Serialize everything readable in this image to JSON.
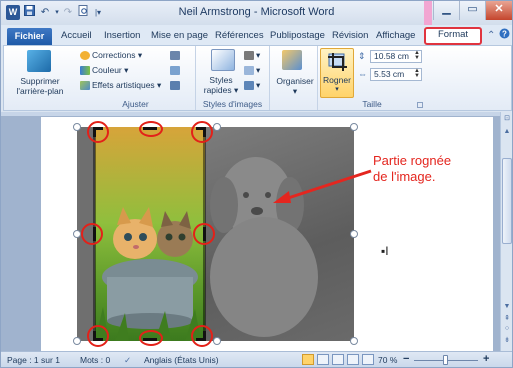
{
  "window": {
    "title": "Neil Armstrong - Microsoft Word"
  },
  "quick_access": {
    "app_icon": "word-icon",
    "save": "save-icon",
    "undo": "undo-icon",
    "redo": "redo-icon",
    "print_preview": "print-preview-icon",
    "customize": "customize-qat-icon"
  },
  "window_buttons": {
    "minimize": "▁",
    "maximize": "▭",
    "close": "✕"
  },
  "tabs": {
    "file": "Fichier",
    "items": [
      "Accueil",
      "Insertion",
      "Mise en page",
      "Références",
      "Publipostage",
      "Révision",
      "Affichage"
    ],
    "format": "Format",
    "active": "Format"
  },
  "ribbon": {
    "remove_bg": {
      "line1": "Supprimer",
      "line2": "l'arrière-plan"
    },
    "adjust": {
      "corrections": "Corrections ▾",
      "color": "Couleur ▾",
      "artistic": "Effets artistiques ▾",
      "label": "Ajuster"
    },
    "styles": {
      "button_line1": "Styles",
      "button_line2": "rapides ▾",
      "label": "Styles d'images"
    },
    "arrange": {
      "button": "Organiser",
      "arrow": "▾"
    },
    "size": {
      "crop": "Rogner",
      "crop_arrow": "▾",
      "height": "10.58 cm",
      "width": "5.53 cm",
      "label": "Taille"
    }
  },
  "document": {
    "annotation": "Partie rognée de l'image.",
    "annotation_color": "#e4261f",
    "crop_circle_color": "#e32119"
  },
  "statusbar": {
    "page": "Page : 1 sur 1",
    "words": "Mots : 0",
    "language": "Anglais (États Unis)",
    "zoom": "70 %",
    "zoom_level": 0.5,
    "zoom_minus": "−",
    "zoom_plus": "+"
  }
}
